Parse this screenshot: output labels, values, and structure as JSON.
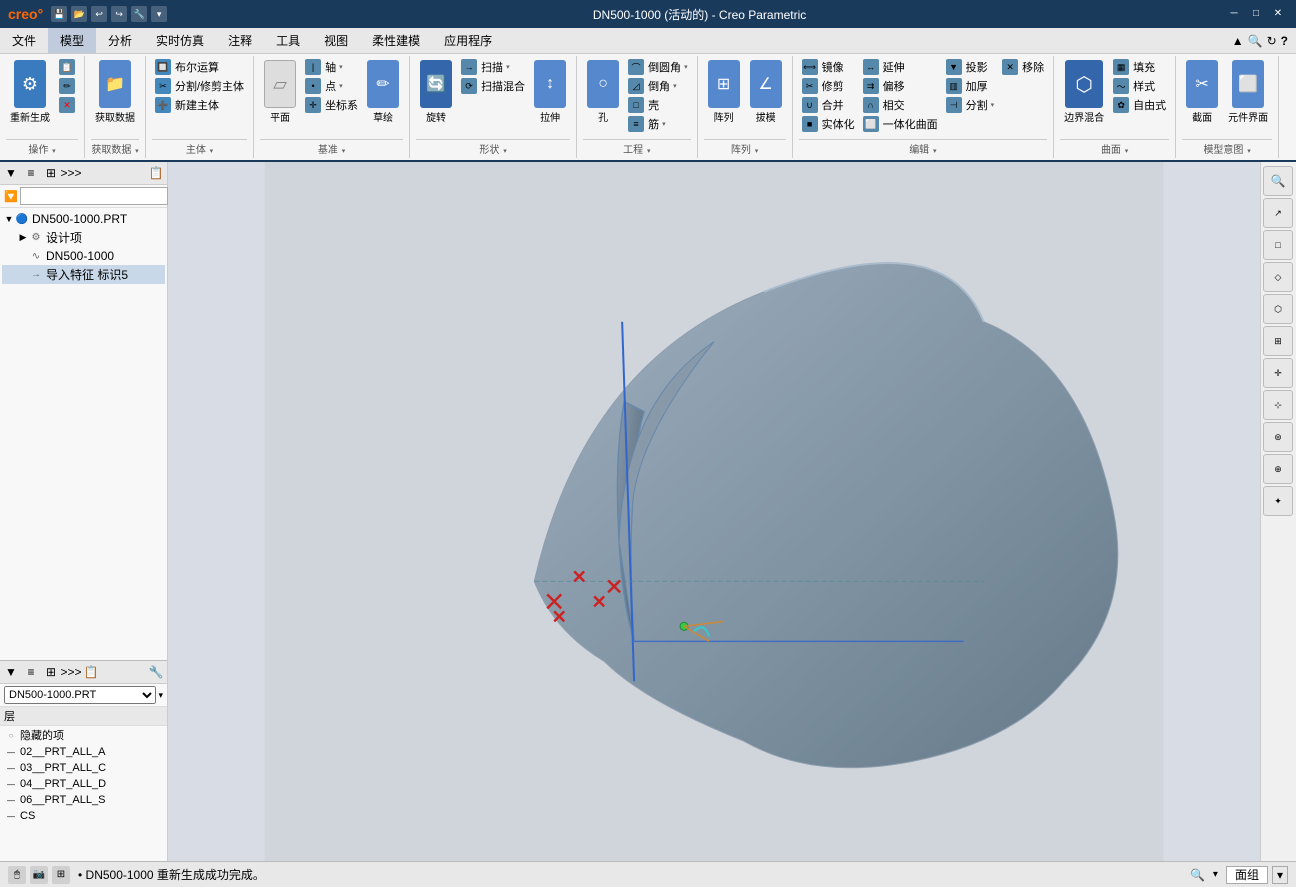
{
  "titlebar": {
    "logo": "creo°",
    "title": "DN500-1000 (活动的) - Creo Parametric",
    "qa_icons": [
      "💾",
      "📂",
      "↩",
      "↪",
      "🔧"
    ],
    "win_btns": [
      "─",
      "□",
      "✕"
    ]
  },
  "menubar": {
    "items": [
      "文件",
      "模型",
      "分析",
      "实时仿真",
      "注释",
      "工具",
      "视图",
      "柔性建模",
      "应用程序"
    ]
  },
  "ribbon": {
    "active_tab": "模型",
    "groups": [
      {
        "name": "操作",
        "buttons": [
          {
            "label": "重新生成",
            "icon": "⚙",
            "type": "large"
          },
          {
            "label": "",
            "icon": "📋",
            "type": "small"
          },
          {
            "label": "",
            "icon": "✏",
            "type": "small"
          },
          {
            "label": "",
            "icon": "✕",
            "type": "small"
          }
        ]
      },
      {
        "name": "获取数据",
        "buttons": [
          {
            "label": "",
            "icon": "📁",
            "type": "small"
          }
        ]
      },
      {
        "name": "主体",
        "buttons": [
          {
            "label": "布尔运算",
            "icon": "🔲"
          },
          {
            "label": "分割/修剪主体",
            "icon": "✂"
          },
          {
            "label": "新建主体",
            "icon": "➕"
          }
        ]
      },
      {
        "name": "基准",
        "buttons": [
          {
            "label": "轴",
            "icon": "📏"
          },
          {
            "label": "点",
            "icon": "•"
          },
          {
            "label": "平面",
            "icon": "▱"
          },
          {
            "label": "坐标系",
            "icon": "✛"
          },
          {
            "label": "草绘",
            "icon": "✏"
          }
        ]
      },
      {
        "name": "形状",
        "buttons": [
          {
            "label": "旋转",
            "icon": "🔄"
          },
          {
            "label": "扫描",
            "icon": "→"
          },
          {
            "label": "扫描混合",
            "icon": "⟳"
          },
          {
            "label": "拉伸",
            "icon": "↕"
          }
        ]
      },
      {
        "name": "工程",
        "buttons": [
          {
            "label": "孔",
            "icon": "○"
          },
          {
            "label": "倒圆角",
            "icon": "⌒"
          },
          {
            "label": "倒角",
            "icon": "◿"
          },
          {
            "label": "壳",
            "icon": "□"
          },
          {
            "label": "筋",
            "icon": "≡"
          }
        ]
      },
      {
        "name": "阵列",
        "buttons": [
          {
            "label": "阵列",
            "icon": "⊞"
          },
          {
            "label": "拔模",
            "icon": "∠"
          }
        ]
      },
      {
        "name": "编辑",
        "buttons": [
          {
            "label": "镜像",
            "icon": "⟺"
          },
          {
            "label": "延伸",
            "icon": "↔"
          },
          {
            "label": "投影",
            "icon": "▼"
          },
          {
            "label": "移除",
            "icon": "✕"
          },
          {
            "label": "修剪",
            "icon": "✂"
          },
          {
            "label": "偏移",
            "icon": "⇉"
          },
          {
            "label": "加厚",
            "icon": "▥"
          },
          {
            "label": "分割",
            "icon": "⊣"
          },
          {
            "label": "合并",
            "icon": "∪"
          },
          {
            "label": "相交",
            "icon": "∩"
          },
          {
            "label": "实体化",
            "icon": "■"
          },
          {
            "label": "一体化曲面",
            "icon": "⬜"
          }
        ]
      },
      {
        "name": "曲面",
        "buttons": [
          {
            "label": "边界混合",
            "icon": "⬡"
          },
          {
            "label": "填充",
            "icon": "▦"
          },
          {
            "label": "样式",
            "icon": "〜"
          },
          {
            "label": "自由式",
            "icon": "✿"
          }
        ]
      },
      {
        "name": "模型意图",
        "buttons": [
          {
            "label": "截面",
            "icon": "✂"
          },
          {
            "label": "元件界面",
            "icon": "⬜"
          }
        ]
      }
    ]
  },
  "left_panel": {
    "tree_toolbar": [
      "▼",
      "≡",
      "⊞",
      "≫",
      "📋"
    ],
    "filter_placeholder": "",
    "tree_items": [
      {
        "label": "DN500-1000.PRT",
        "level": 0,
        "icon": "🔵",
        "expanded": true
      },
      {
        "label": "设计项",
        "level": 1,
        "icon": "⚙",
        "expanded": false
      },
      {
        "label": "DN500-1000",
        "level": 1,
        "icon": "∿"
      },
      {
        "label": "导入特征 标识5",
        "level": 1,
        "icon": "→"
      }
    ]
  },
  "left_bottom": {
    "toolbar": [
      "▼",
      "≡",
      "⊞",
      "≫",
      "📋",
      "🔧"
    ],
    "layer_selector": "DN500-1000.PRT",
    "layer_title": "层",
    "layers": [
      {
        "label": "隐藏的项",
        "icon": "○",
        "color": "#888"
      },
      {
        "label": "02__PRT_ALL_A",
        "icon": "—"
      },
      {
        "label": "03__PRT_ALL_C",
        "icon": "—"
      },
      {
        "label": "04__PRT_ALL_D",
        "icon": "—"
      },
      {
        "label": "06__PRT_ALL_S",
        "icon": "—"
      },
      {
        "label": "CS",
        "icon": "—"
      }
    ]
  },
  "viewport": {
    "background": "#d8dde5"
  },
  "right_toolbar": {
    "buttons": [
      {
        "icon": "🔍",
        "title": "缩放"
      },
      {
        "icon": "↗",
        "title": ""
      },
      {
        "icon": "□",
        "title": ""
      },
      {
        "icon": "◇",
        "title": ""
      },
      {
        "icon": "⬡",
        "title": ""
      },
      {
        "icon": "⊞",
        "title": ""
      },
      {
        "icon": "✛",
        "title": ""
      },
      {
        "icon": "⊹",
        "title": ""
      },
      {
        "icon": "⊛",
        "title": ""
      },
      {
        "icon": "⊕",
        "title": ""
      },
      {
        "icon": "✦",
        "title": ""
      }
    ]
  },
  "statusbar": {
    "icons": [
      "🖱",
      "📷",
      "⊞"
    ],
    "status_text": "• DN500-1000 重新生成成功完成。",
    "search_icon": "🔍",
    "face_label": "面组",
    "dropdown": "▼"
  }
}
